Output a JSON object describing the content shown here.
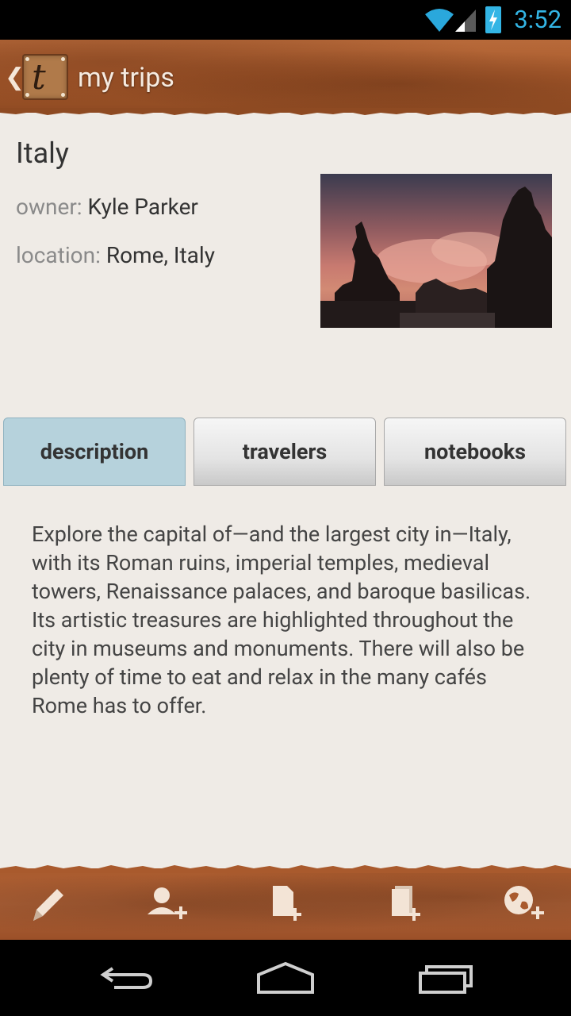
{
  "status_bar": {
    "time": "3:52",
    "icons": [
      "wifi-icon",
      "signal-icon",
      "battery-charging-icon"
    ],
    "accent_color": "#33b5e5"
  },
  "action_bar": {
    "logo_letter": "t",
    "title": "my trips"
  },
  "trip": {
    "title": "Italy",
    "owner_label": "owner:",
    "owner": "Kyle Parker",
    "location_label": "location:",
    "location": "Rome, Italy"
  },
  "tabs": [
    {
      "label": "description",
      "active": true
    },
    {
      "label": "travelers",
      "active": false
    },
    {
      "label": "notebooks",
      "active": false
    }
  ],
  "description": "Explore the capital of—and the largest city in—Italy, with its Roman ruins, imperial temples, medieval towers, Renaissance palaces, and baroque basilicas. Its artistic treasures are highlighted throughout the city in museums and monuments. There will also be plenty of time to eat and relax in the many cafés Rome has to offer.",
  "toolbar": {
    "icons": [
      "pencil-icon",
      "add-person-icon",
      "add-document-icon",
      "add-notebook-icon",
      "add-globe-icon"
    ]
  },
  "nav_bar": {
    "icons": [
      "back-icon",
      "home-icon",
      "recents-icon"
    ]
  },
  "colors": {
    "active_tab": "#b6d2dc",
    "leather": "#a85a2c",
    "background": "#efebe6"
  }
}
